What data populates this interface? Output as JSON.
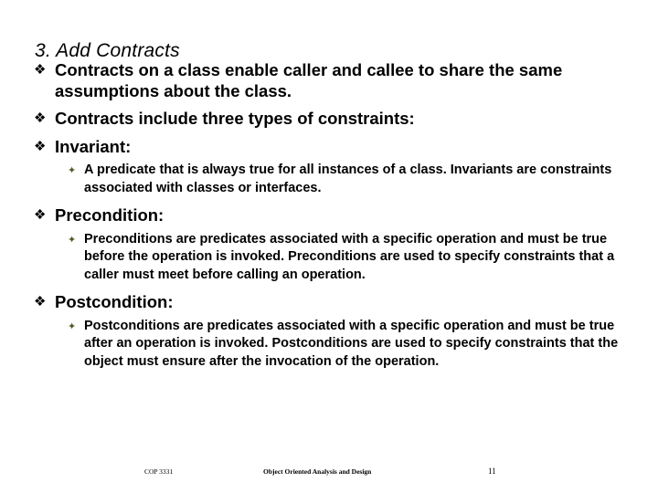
{
  "slide": {
    "title": "3. Add Contracts",
    "bullet_marker": "❖",
    "sub_bullet_marker": "✦",
    "sub_bullet_color": "#4f5b23",
    "background_color": "#ffffff",
    "text_color": "#000000",
    "items": [
      {
        "level": 1,
        "text": "Contracts on a class enable caller and callee to share the same assumptions about the class."
      },
      {
        "level": 1,
        "text": "Contracts include three types of constraints:"
      },
      {
        "level": 1,
        "text": "Invariant:"
      },
      {
        "level": 2,
        "text": "A predicate that is always true for all instances of a class. Invariants are constraints associated with classes or interfaces."
      },
      {
        "level": 1,
        "text": "Precondition:"
      },
      {
        "level": 2,
        "text": "Preconditions are predicates associated with a specific operation and must be true before the operation is invoked. Preconditions are used to specify constraints that a caller must meet before calling an operation."
      },
      {
        "level": 1,
        "text": "Postcondition:"
      },
      {
        "level": 2,
        "text": "Postconditions are predicates associated with a specific operation and must be true after an operation is invoked. Postconditions are used to specify constraints that the object must ensure after the invocation of the operation."
      }
    ]
  },
  "footer": {
    "course_code": "COP 3331",
    "course_title": "Object Oriented Analysis and Design",
    "page_number": "11"
  }
}
